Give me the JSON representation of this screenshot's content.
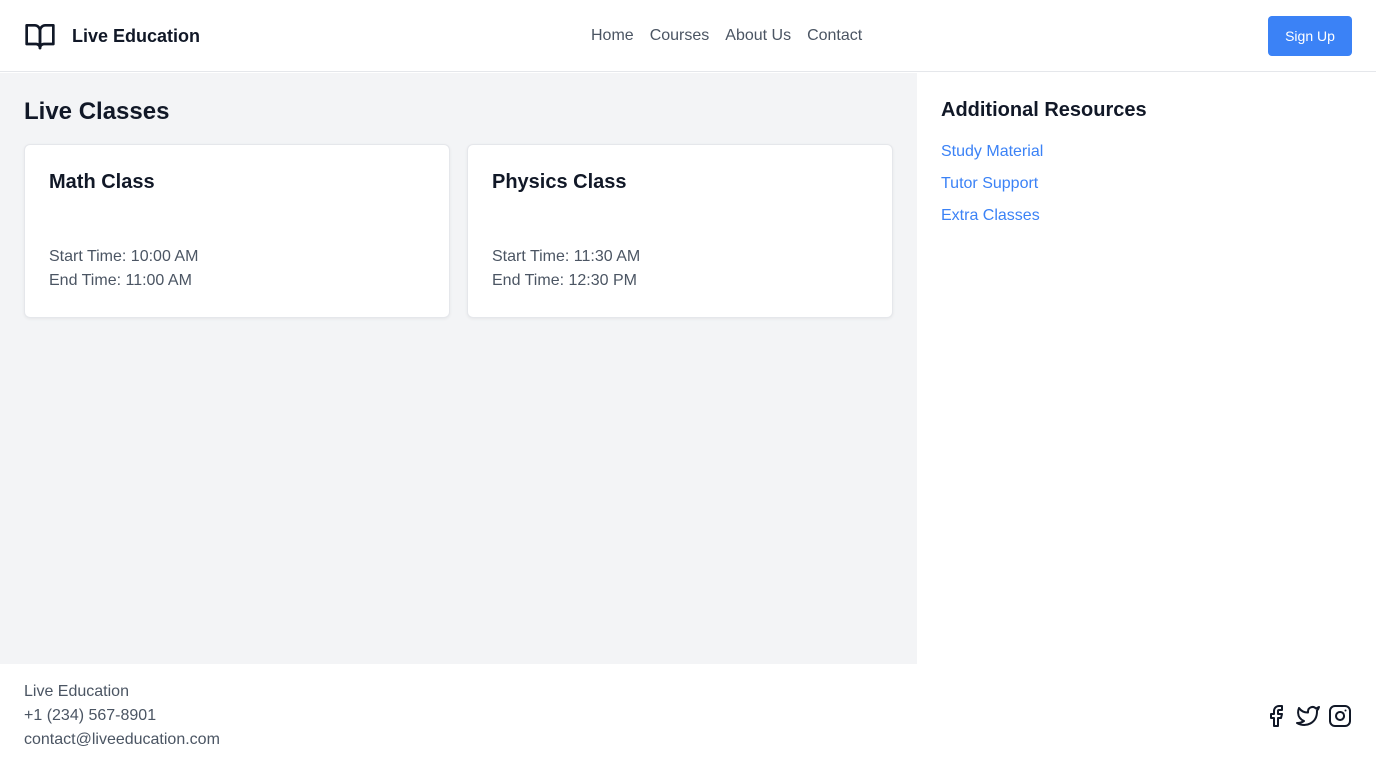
{
  "header": {
    "brand_name": "Live Education",
    "brand_icon": "book-open-icon",
    "nav": [
      "Home",
      "Courses",
      "About Us",
      "Contact"
    ],
    "signup_label": "Sign Up"
  },
  "main": {
    "title": "Live Classes",
    "classes": [
      {
        "name": "Math Class",
        "start": "Start Time: 10:00 AM",
        "end": "End Time: 11:00 AM"
      },
      {
        "name": "Physics Class",
        "start": "Start Time: 11:30 AM",
        "end": "End Time: 12:30 PM"
      }
    ]
  },
  "aside": {
    "title": "Additional Resources",
    "links": [
      "Study Material",
      "Tutor Support",
      "Extra Classes"
    ]
  },
  "footer": {
    "name": "Live Education",
    "phone": "+1 (234) 567-8901",
    "email": "contact@liveeducation.com",
    "socials": [
      "facebook-icon",
      "twitter-icon",
      "instagram-icon"
    ]
  },
  "colors": {
    "accent": "#3b82f6",
    "main_bg": "#f3f4f6",
    "text": "#111827",
    "muted_text": "#4b5563"
  }
}
